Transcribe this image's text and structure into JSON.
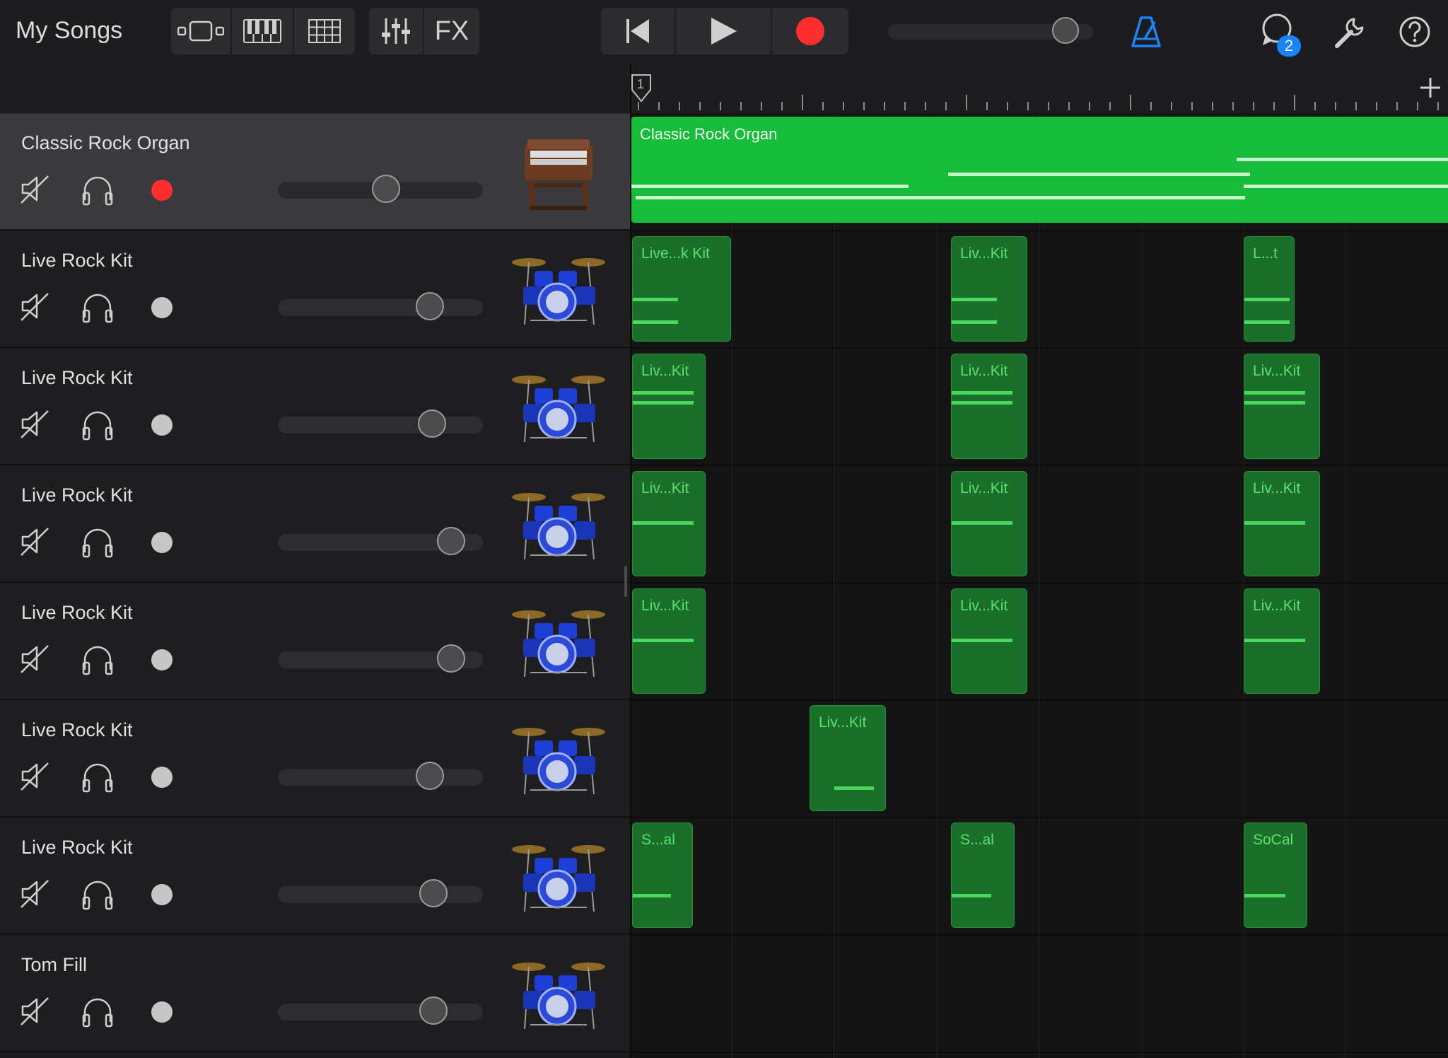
{
  "toolbar": {
    "title": "My Songs",
    "view_buttons": [
      "tracks-view",
      "keyboard",
      "grid"
    ],
    "fx_label": "FX",
    "loop_badge": "2",
    "colors": {
      "record": "#ff2d2d",
      "metronome": "#1a84ff",
      "badge": "#1a84ff"
    }
  },
  "ruler": {
    "first_bar": "1"
  },
  "tracks": [
    {
      "name": "Classic Rock Organ",
      "selected": true,
      "armed": true,
      "volume": 0.53,
      "instrument": "organ"
    },
    {
      "name": "Live Rock Kit",
      "selected": false,
      "armed": false,
      "volume": 0.78,
      "instrument": "drums"
    },
    {
      "name": "Live Rock Kit",
      "selected": false,
      "armed": false,
      "volume": 0.79,
      "instrument": "drums"
    },
    {
      "name": "Live Rock Kit",
      "selected": false,
      "armed": false,
      "volume": 0.9,
      "instrument": "drums"
    },
    {
      "name": "Live Rock Kit",
      "selected": false,
      "armed": false,
      "volume": 0.9,
      "instrument": "drums"
    },
    {
      "name": "Live Rock Kit",
      "selected": false,
      "armed": false,
      "volume": 0.78,
      "instrument": "drums"
    },
    {
      "name": "Live Rock Kit",
      "selected": false,
      "armed": false,
      "volume": 0.8,
      "instrument": "drums"
    },
    {
      "name": "Tom Fill",
      "selected": false,
      "armed": false,
      "volume": 0.8,
      "instrument": "drums"
    }
  ],
  "regions": {
    "organ": "Classic Rock Organ",
    "lane1": [
      "Live...k Kit",
      "Liv...Kit",
      "L...t"
    ],
    "lane2": [
      "Liv...Kit",
      "Liv...Kit",
      "Liv...Kit"
    ],
    "lane3": [
      "Liv...Kit",
      "Liv...Kit",
      "Liv...Kit"
    ],
    "lane4": [
      "Liv...Kit",
      "Liv...Kit",
      "Liv...Kit"
    ],
    "lane5": [
      "Liv...Kit"
    ],
    "lane6": [
      "S...al",
      "S...al",
      "SoCal"
    ]
  }
}
